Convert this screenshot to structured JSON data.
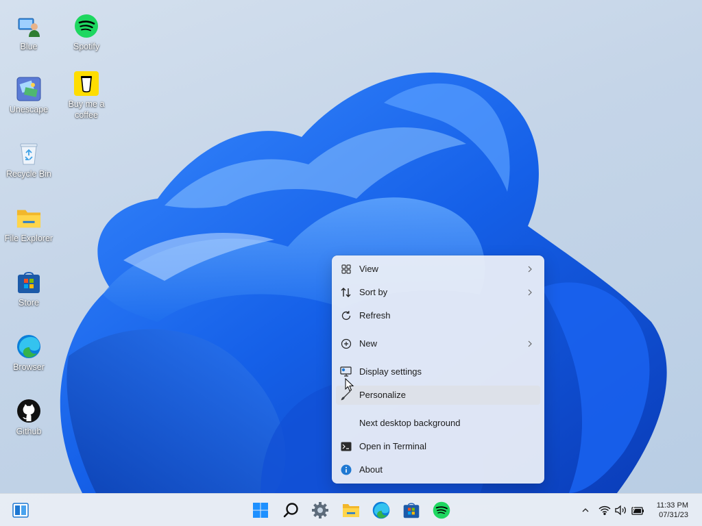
{
  "desktop_icons": [
    {
      "label": "Blue",
      "icon": "user-computer-icon"
    },
    {
      "label": "Spotify",
      "icon": "spotify-icon"
    },
    {
      "label": "Unescape",
      "icon": "unescape-app-icon"
    },
    {
      "label": "Buy me a coffee",
      "icon": "coffee-cup-icon"
    },
    {
      "label": "Recycle Bin",
      "icon": "recycle-bin-icon"
    },
    {
      "label": "File Explorer",
      "icon": "folder-icon"
    },
    {
      "label": "Store",
      "icon": "store-icon"
    },
    {
      "label": "Browser",
      "icon": "edge-icon"
    },
    {
      "label": "Github",
      "icon": "github-icon"
    }
  ],
  "context_menu": {
    "items": [
      {
        "label": "View",
        "icon": "grid-icon",
        "submenu": true
      },
      {
        "label": "Sort by",
        "icon": "sort-arrows-icon",
        "submenu": true
      },
      {
        "label": "Refresh",
        "icon": "refresh-icon",
        "submenu": false
      },
      {
        "label": "New",
        "icon": "plus-circle-icon",
        "submenu": true
      },
      {
        "label": "Display settings",
        "icon": "display-settings-icon",
        "submenu": false
      },
      {
        "label": "Personalize",
        "icon": "brush-icon",
        "submenu": false,
        "highlighted": true
      },
      {
        "label": "Next desktop background",
        "icon": "",
        "submenu": false
      },
      {
        "label": "Open in Terminal",
        "icon": "terminal-icon",
        "submenu": false
      },
      {
        "label": "About",
        "icon": "info-icon",
        "submenu": false
      }
    ]
  },
  "taskbar": {
    "left_button": "widgets-icon",
    "pinned": [
      "windows-start-icon",
      "search-icon",
      "settings-gear-icon",
      "file-explorer-icon",
      "edge-icon",
      "store-icon",
      "spotify-icon"
    ],
    "tray": [
      "chevron-up-icon",
      "wifi-icon",
      "volume-icon",
      "battery-icon"
    ],
    "clock": {
      "time": "11:33 PM",
      "date": "07/31/23"
    }
  },
  "colors": {
    "accent": "#0078d4",
    "spotify_green": "#1ed760",
    "menu_bg": "#eef1f8",
    "menu_hover": "#dde1e9",
    "wallpaper_bloom": "#1a5fe0"
  }
}
